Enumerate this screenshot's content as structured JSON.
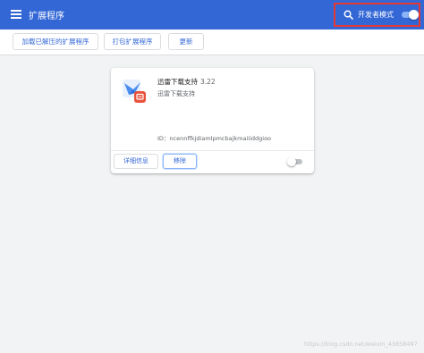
{
  "header": {
    "title": "扩展程序",
    "dev_mode_label": "开发者模式",
    "dev_mode_enabled": true,
    "bar_color": "#3367d6",
    "highlight_color": "#e53935"
  },
  "toolbar": {
    "load_unpacked": "加载已解压的扩展程序",
    "pack_extension": "打包扩展程序",
    "update": "更新"
  },
  "extension": {
    "name": "迅雷下载支持",
    "version": "3.22",
    "description": "迅雷下载支持",
    "id_text": "ID：ncennffkjdiamlpmcbajkmaiiiddgioo",
    "enabled": false,
    "details_label": "详细信息",
    "remove_label": "移除",
    "icon": "thunder-bird-icon"
  },
  "watermark": "https://blog.csdn.net/weixin_43858497"
}
